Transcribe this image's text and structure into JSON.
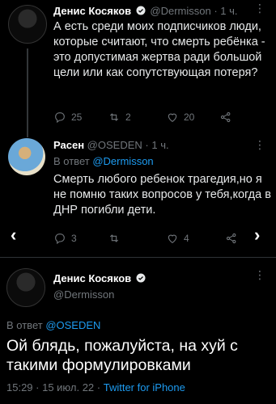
{
  "tweet1": {
    "name": "Денис Косяков",
    "handle": "@Dermisson",
    "time": "· 1 ч.",
    "text": "А есть среди моих подписчиков люди, которые считают, что смерть ребёнка - это допустимая жертва ради большой цели или как сопутствующая потеря?",
    "replies": "25",
    "retweets": "2",
    "likes": "20"
  },
  "tweet2": {
    "name": "Расен",
    "handle": "@OSEDEN",
    "time": "· 1 ч.",
    "reply_prefix": "В ответ",
    "reply_to": "@Dermisson",
    "text": "Смерть любого ребенок трагедия,но я не помню таких вопросов у тебя,когда в ДНР погибли дети.",
    "replies": "3",
    "retweets": "",
    "likes": "4"
  },
  "tweet3": {
    "name": "Денис Косяков",
    "handle": "@Dermisson",
    "reply_prefix": "В ответ",
    "reply_to": "@OSEDEN",
    "text": "Ой блядь, пожалуйста, на хуй с такими формулировками",
    "time": "15:29 · 15 июл. 22 ·",
    "source": "Twitter for iPhone"
  },
  "icons": {
    "verified_color": "#1d9bf0",
    "nav_prev": "‹",
    "nav_next": "›"
  }
}
